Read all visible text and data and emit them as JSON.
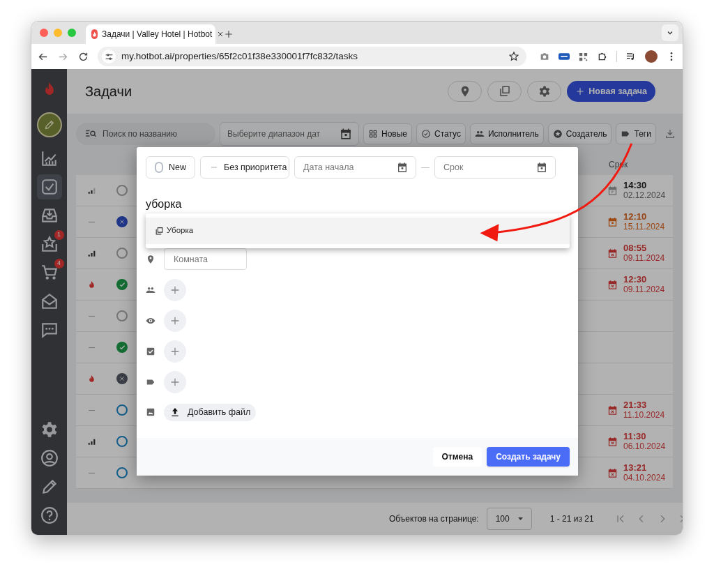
{
  "browser": {
    "tab_title": "Задачи | Valley Hotel | Hotbot",
    "url": "my.hotbot.ai/properties/65f2c01f38e330001f7fc832/tasks"
  },
  "sidebar": {
    "items": [
      {
        "kind": "chart",
        "selected": false
      },
      {
        "kind": "tasks",
        "selected": true
      },
      {
        "kind": "inbox",
        "selected": false
      },
      {
        "kind": "star",
        "selected": false,
        "badge": "1"
      },
      {
        "kind": "cart",
        "selected": false,
        "badge": "4"
      },
      {
        "kind": "mail",
        "selected": false
      },
      {
        "kind": "chat",
        "selected": false
      }
    ],
    "bottom_items": [
      {
        "kind": "settings",
        "selected": false
      },
      {
        "kind": "profile",
        "selected": false
      },
      {
        "kind": "pencil",
        "selected": false
      },
      {
        "kind": "help",
        "selected": false
      }
    ]
  },
  "header": {
    "title": "Задачи",
    "new_task_button": "Новая задача"
  },
  "filters": {
    "search_placeholder": "Поиск по названию",
    "date_range_placeholder": "Выберите диапазон дат",
    "chips": [
      {
        "kind": "grid",
        "label": "Новые"
      },
      {
        "kind": "status",
        "label": "Статус"
      },
      {
        "kind": "people",
        "label": "Исполнитель"
      },
      {
        "kind": "creator",
        "label": "Создатель"
      },
      {
        "kind": "tag",
        "label": "Теги"
      }
    ]
  },
  "table": {
    "due_header": "Срок",
    "rows": [
      {
        "priority": {
          "kind": "medium"
        },
        "status": {
          "kind": "open"
        },
        "due": {
          "kind": "upcoming",
          "time": "14:30",
          "date": "02.12.2024"
        }
      },
      {
        "priority": {
          "kind": "none"
        },
        "status": {
          "kind": "cancelled"
        },
        "due": {
          "kind": "today",
          "time": "12:10",
          "date": "15.11.2024"
        }
      },
      {
        "priority": {
          "kind": "high"
        },
        "status": {
          "kind": "open"
        },
        "due": {
          "kind": "overdue",
          "time": "08:55",
          "date": "09.11.2024"
        }
      },
      {
        "priority": {
          "kind": "urgent"
        },
        "status": {
          "kind": "done"
        },
        "due": {
          "kind": "overdue",
          "time": "12:30",
          "date": "09.11.2024"
        }
      },
      {
        "priority": {
          "kind": "none"
        },
        "status": {
          "kind": "open"
        }
      },
      {
        "priority": {
          "kind": "none"
        },
        "status": {
          "kind": "done"
        }
      },
      {
        "priority": {
          "kind": "urgent"
        },
        "status": {
          "kind": "closed"
        }
      },
      {
        "priority": {
          "kind": "none"
        },
        "status": {
          "kind": "progress"
        },
        "due": {
          "kind": "overdue",
          "time": "21:33",
          "date": "11.10.2024"
        }
      },
      {
        "priority": {
          "kind": "high"
        },
        "status": {
          "kind": "progress"
        },
        "due": {
          "kind": "overdue",
          "time": "11:30",
          "date": "06.10.2024"
        }
      },
      {
        "priority": {
          "kind": "none"
        },
        "status": {
          "kind": "progress"
        },
        "due": {
          "kind": "overdue",
          "time": "13:21",
          "date": "04.10.2024"
        }
      }
    ]
  },
  "modal": {
    "status_label": "New",
    "priority_label": "Без приоритета",
    "start_placeholder": "Дата начала",
    "separator": "—",
    "due_placeholder": "Срок",
    "title_value": "уборка",
    "suggestions": [
      {
        "label": "Уборка",
        "selected": true
      }
    ],
    "room_placeholder": "Комната",
    "attach_button": "Добавить файл",
    "cancel_button": "Отмена",
    "create_button": "Создать задачу"
  },
  "pagination": {
    "per_page_label": "Объектов на странице:",
    "per_page": "100",
    "range": "1 - 21 из 21"
  }
}
